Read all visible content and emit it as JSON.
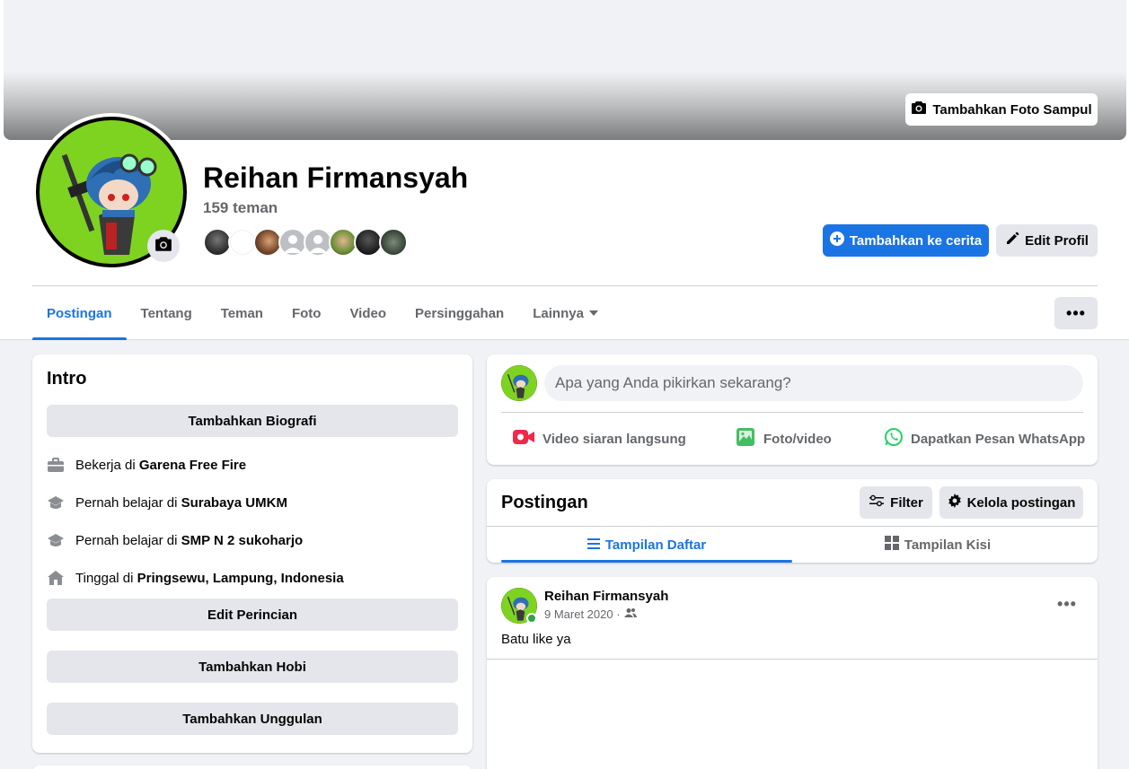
{
  "cover": {
    "add_cover_label": "Tambahkan Foto Sampul"
  },
  "profile": {
    "name": "Reihan Firmansyah",
    "friends_count": "159 teman",
    "add_story_label": "Tambahkan ke cerita",
    "edit_profile_label": "Edit Profil"
  },
  "tabs": [
    {
      "label": "Postingan"
    },
    {
      "label": "Tentang"
    },
    {
      "label": "Teman"
    },
    {
      "label": "Foto"
    },
    {
      "label": "Video"
    },
    {
      "label": "Persinggahan"
    },
    {
      "label": "Lainnya"
    }
  ],
  "more_dots": "•••",
  "intro": {
    "title": "Intro",
    "add_bio": "Tambahkan Biografi",
    "items": [
      {
        "prefix": "Bekerja di ",
        "value": "Garena Free Fire"
      },
      {
        "prefix": "Pernah belajar di ",
        "value": "Surabaya UMKM"
      },
      {
        "prefix": "Pernah belajar di ",
        "value": "SMP N 2 sukoharjo"
      },
      {
        "prefix": "Tinggal di ",
        "value": "Pringsewu, Lampung, Indonesia"
      }
    ],
    "edit_details": "Edit Perincian",
    "add_hobbies": "Tambahkan Hobi",
    "add_featured": "Tambahkan Unggulan"
  },
  "composer": {
    "placeholder": "Apa yang Anda pikirkan sekarang?",
    "live_video": "Video siaran langsung",
    "photo_video": "Foto/video",
    "whatsapp": "Dapatkan Pesan WhatsApp"
  },
  "posts_section": {
    "title": "Postingan",
    "filter": "Filter",
    "manage": "Kelola postingan",
    "list_view": "Tampilan Daftar",
    "grid_view": "Tampilan Kisi"
  },
  "post": {
    "author": "Reihan Firmansyah",
    "date": "9 Maret 2020 ·",
    "text": "Batu like ya"
  },
  "colors": {
    "accent": "#1b74e4",
    "online": "#31a24c",
    "avatar_bg": "#7ed321"
  },
  "icons": [
    "camera-icon",
    "plus-circle-icon",
    "pencil-icon",
    "briefcase-icon",
    "graduation-cap-icon",
    "home-icon",
    "video-camera-icon",
    "photo-icon",
    "whatsapp-icon",
    "filter-icon",
    "gear-icon",
    "list-icon",
    "grid-icon",
    "friends-audience-icon"
  ]
}
